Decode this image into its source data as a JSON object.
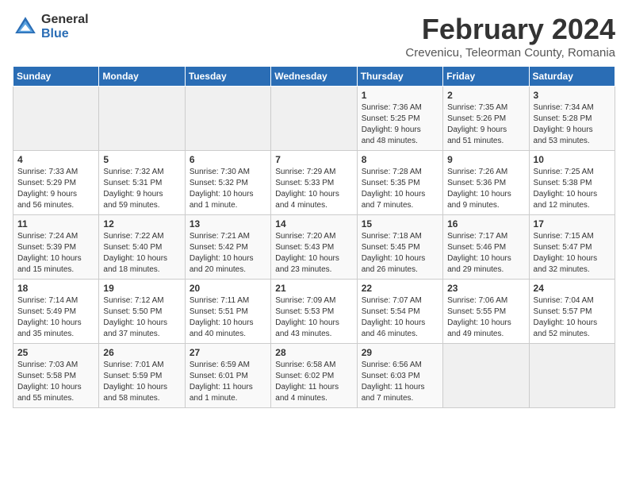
{
  "logo": {
    "general": "General",
    "blue": "Blue"
  },
  "title": {
    "month_year": "February 2024",
    "location": "Crevenicu, Teleorman County, Romania"
  },
  "days_header": [
    "Sunday",
    "Monday",
    "Tuesday",
    "Wednesday",
    "Thursday",
    "Friday",
    "Saturday"
  ],
  "weeks": [
    [
      {
        "day": "",
        "info": ""
      },
      {
        "day": "",
        "info": ""
      },
      {
        "day": "",
        "info": ""
      },
      {
        "day": "",
        "info": ""
      },
      {
        "day": "1",
        "info": "Sunrise: 7:36 AM\nSunset: 5:25 PM\nDaylight: 9 hours\nand 48 minutes."
      },
      {
        "day": "2",
        "info": "Sunrise: 7:35 AM\nSunset: 5:26 PM\nDaylight: 9 hours\nand 51 minutes."
      },
      {
        "day": "3",
        "info": "Sunrise: 7:34 AM\nSunset: 5:28 PM\nDaylight: 9 hours\nand 53 minutes."
      }
    ],
    [
      {
        "day": "4",
        "info": "Sunrise: 7:33 AM\nSunset: 5:29 PM\nDaylight: 9 hours\nand 56 minutes."
      },
      {
        "day": "5",
        "info": "Sunrise: 7:32 AM\nSunset: 5:31 PM\nDaylight: 9 hours\nand 59 minutes."
      },
      {
        "day": "6",
        "info": "Sunrise: 7:30 AM\nSunset: 5:32 PM\nDaylight: 10 hours\nand 1 minute."
      },
      {
        "day": "7",
        "info": "Sunrise: 7:29 AM\nSunset: 5:33 PM\nDaylight: 10 hours\nand 4 minutes."
      },
      {
        "day": "8",
        "info": "Sunrise: 7:28 AM\nSunset: 5:35 PM\nDaylight: 10 hours\nand 7 minutes."
      },
      {
        "day": "9",
        "info": "Sunrise: 7:26 AM\nSunset: 5:36 PM\nDaylight: 10 hours\nand 9 minutes."
      },
      {
        "day": "10",
        "info": "Sunrise: 7:25 AM\nSunset: 5:38 PM\nDaylight: 10 hours\nand 12 minutes."
      }
    ],
    [
      {
        "day": "11",
        "info": "Sunrise: 7:24 AM\nSunset: 5:39 PM\nDaylight: 10 hours\nand 15 minutes."
      },
      {
        "day": "12",
        "info": "Sunrise: 7:22 AM\nSunset: 5:40 PM\nDaylight: 10 hours\nand 18 minutes."
      },
      {
        "day": "13",
        "info": "Sunrise: 7:21 AM\nSunset: 5:42 PM\nDaylight: 10 hours\nand 20 minutes."
      },
      {
        "day": "14",
        "info": "Sunrise: 7:20 AM\nSunset: 5:43 PM\nDaylight: 10 hours\nand 23 minutes."
      },
      {
        "day": "15",
        "info": "Sunrise: 7:18 AM\nSunset: 5:45 PM\nDaylight: 10 hours\nand 26 minutes."
      },
      {
        "day": "16",
        "info": "Sunrise: 7:17 AM\nSunset: 5:46 PM\nDaylight: 10 hours\nand 29 minutes."
      },
      {
        "day": "17",
        "info": "Sunrise: 7:15 AM\nSunset: 5:47 PM\nDaylight: 10 hours\nand 32 minutes."
      }
    ],
    [
      {
        "day": "18",
        "info": "Sunrise: 7:14 AM\nSunset: 5:49 PM\nDaylight: 10 hours\nand 35 minutes."
      },
      {
        "day": "19",
        "info": "Sunrise: 7:12 AM\nSunset: 5:50 PM\nDaylight: 10 hours\nand 37 minutes."
      },
      {
        "day": "20",
        "info": "Sunrise: 7:11 AM\nSunset: 5:51 PM\nDaylight: 10 hours\nand 40 minutes."
      },
      {
        "day": "21",
        "info": "Sunrise: 7:09 AM\nSunset: 5:53 PM\nDaylight: 10 hours\nand 43 minutes."
      },
      {
        "day": "22",
        "info": "Sunrise: 7:07 AM\nSunset: 5:54 PM\nDaylight: 10 hours\nand 46 minutes."
      },
      {
        "day": "23",
        "info": "Sunrise: 7:06 AM\nSunset: 5:55 PM\nDaylight: 10 hours\nand 49 minutes."
      },
      {
        "day": "24",
        "info": "Sunrise: 7:04 AM\nSunset: 5:57 PM\nDaylight: 10 hours\nand 52 minutes."
      }
    ],
    [
      {
        "day": "25",
        "info": "Sunrise: 7:03 AM\nSunset: 5:58 PM\nDaylight: 10 hours\nand 55 minutes."
      },
      {
        "day": "26",
        "info": "Sunrise: 7:01 AM\nSunset: 5:59 PM\nDaylight: 10 hours\nand 58 minutes."
      },
      {
        "day": "27",
        "info": "Sunrise: 6:59 AM\nSunset: 6:01 PM\nDaylight: 11 hours\nand 1 minute."
      },
      {
        "day": "28",
        "info": "Sunrise: 6:58 AM\nSunset: 6:02 PM\nDaylight: 11 hours\nand 4 minutes."
      },
      {
        "day": "29",
        "info": "Sunrise: 6:56 AM\nSunset: 6:03 PM\nDaylight: 11 hours\nand 7 minutes."
      },
      {
        "day": "",
        "info": ""
      },
      {
        "day": "",
        "info": ""
      }
    ]
  ]
}
